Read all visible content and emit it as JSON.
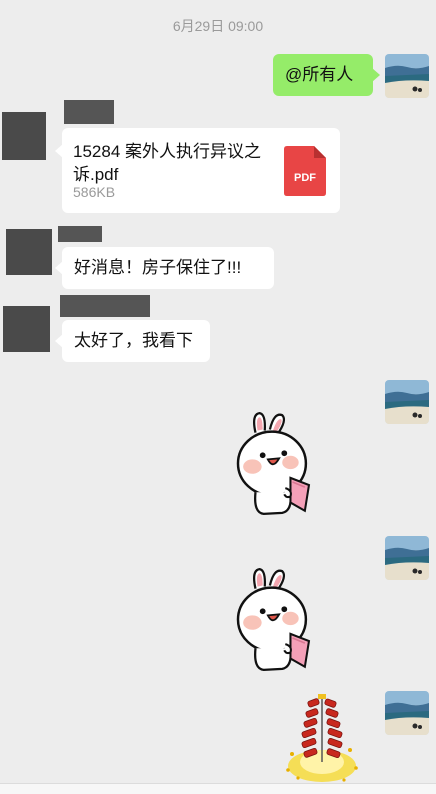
{
  "chat": {
    "timestamp": "6月29日 09:00",
    "messages": [
      {
        "type": "text",
        "side": "right",
        "text": "@所有人"
      },
      {
        "type": "file",
        "side": "left",
        "file_name": "15284 案外人执行异议之诉.pdf",
        "file_size": "586KB",
        "file_icon": "pdf-file-icon",
        "file_icon_label": "PDF"
      },
      {
        "type": "text",
        "side": "left",
        "text": "好消息！房子保住了!!!"
      },
      {
        "type": "text",
        "side": "left",
        "text": "太好了，我看下"
      },
      {
        "type": "sticker",
        "side": "right",
        "sticker": "bunny-sticker"
      },
      {
        "type": "sticker",
        "side": "right",
        "sticker": "bunny-sticker"
      },
      {
        "type": "sticker",
        "side": "right",
        "sticker": "firecracker-sticker"
      }
    ]
  },
  "colors": {
    "background": "#ededed",
    "bubble_self": "#95ec69",
    "bubble_other": "#ffffff",
    "pdf_red": "#e84545"
  }
}
